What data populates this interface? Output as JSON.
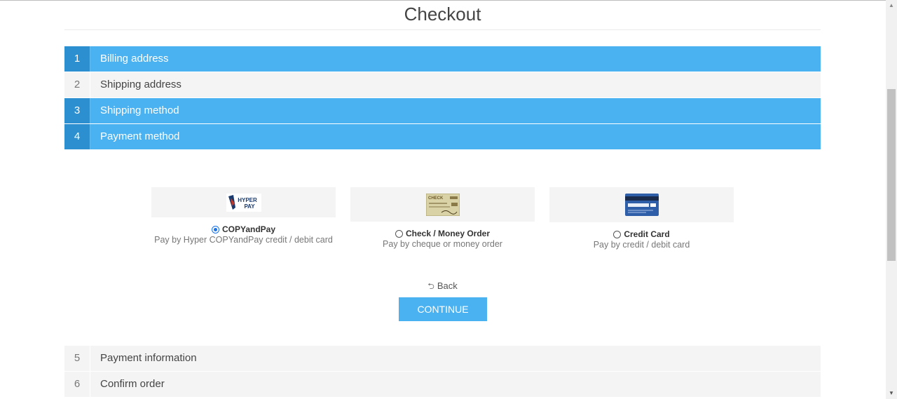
{
  "page": {
    "title": "Checkout"
  },
  "steps_top": [
    {
      "num": "1",
      "label": "Billing address",
      "active": true
    },
    {
      "num": "2",
      "label": "Shipping address",
      "active": false
    },
    {
      "num": "3",
      "label": "Shipping method",
      "active": true
    },
    {
      "num": "4",
      "label": "Payment method",
      "active": true
    }
  ],
  "payment_methods": [
    {
      "name": "COPYandPay",
      "description": "Pay by Hyper COPYandPay credit / debit card",
      "selected": true,
      "logo": "hyperpay-logo",
      "logo_text": "HYPER PAY"
    },
    {
      "name": "Check / Money Order",
      "description": "Pay by cheque or money order",
      "selected": false,
      "logo": "check-image",
      "logo_text": "CHECK"
    },
    {
      "name": "Credit Card",
      "description": "Pay by credit / debit card",
      "selected": false,
      "logo": "credit-card-image"
    }
  ],
  "actions": {
    "back_label": "Back",
    "continue_label": "CONTINUE"
  },
  "steps_bottom": [
    {
      "num": "5",
      "label": "Payment information"
    },
    {
      "num": "6",
      "label": "Confirm order"
    }
  ],
  "colors": {
    "accent": "#4ab2f1",
    "accent_dark": "#2b8fd0",
    "inactive_bg": "#f4f4f4"
  }
}
